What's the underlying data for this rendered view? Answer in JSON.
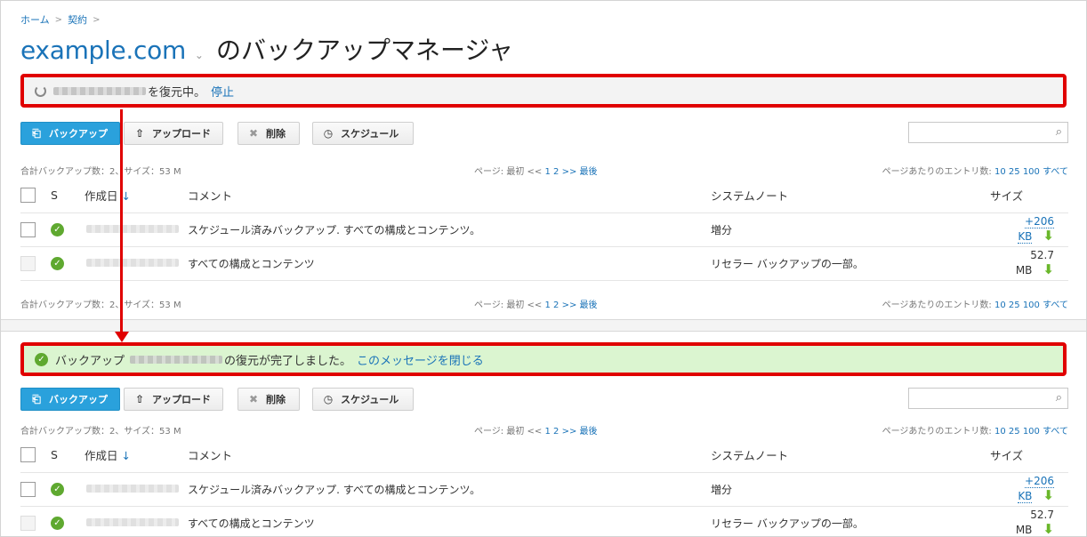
{
  "breadcrumb": {
    "home": "ホーム",
    "contract": "契約",
    "sep": ">"
  },
  "title": {
    "domain": "example.com",
    "caret": "⌄",
    "rest": "のバックアップマネージャ"
  },
  "restore_msg": {
    "suffix": "を復元中。",
    "stop": "停止"
  },
  "done_msg": {
    "prefix": "バックアップ",
    "suffix": "の復元が完了しました。",
    "close": "このメッセージを閉じる"
  },
  "toolbar": {
    "backup": "バックアップ",
    "upload": "アップロード",
    "delete": "削除",
    "schedule": "スケジュール"
  },
  "pager": {
    "total": "合計バックアップ数：2、サイズ：53 M",
    "page_prefix": "ページ: 最初 <<",
    "page1": "1",
    "page2": "2",
    "page_suffix": ">> 最後",
    "per_page": "ページあたりのエントリ数:",
    "opt10": "10",
    "opt25": "25",
    "opt100": "100",
    "opt_all": "すべて"
  },
  "columns": {
    "s": "S",
    "created": "作成日",
    "sort_arrow": "↓",
    "comment": "コメント",
    "note": "システムノート",
    "size": "サイズ"
  },
  "rows": [
    {
      "comment": "スケジュール済みバックアップ. すべての構成とコンテンツ。",
      "note": "増分",
      "size": "+206 KB"
    },
    {
      "comment": "すべての構成とコンテンツ",
      "note": "リセラー バックアップの一部。",
      "size": "52.7 MB"
    }
  ],
  "icons": {
    "ok": "check-circle-icon",
    "download": "download-arrow-icon",
    "search": "search-icon"
  },
  "colors": {
    "link": "#1a73b8",
    "primary": "#2aa1dc",
    "highlight": "#e00000",
    "success_bg": "#dbf5d0"
  }
}
